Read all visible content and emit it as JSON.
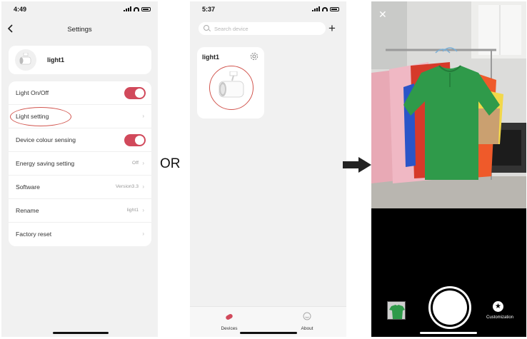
{
  "settings_screen": {
    "time": "4:49",
    "title": "Settings",
    "device_name": "light1",
    "rows": [
      {
        "label": "Light On/Off",
        "value": "",
        "control": "toggle",
        "on": true
      },
      {
        "label": "Light setting",
        "value": "",
        "control": "chevron",
        "highlighted": true
      },
      {
        "label": "Device colour sensing",
        "value": "",
        "control": "toggle",
        "on": true
      },
      {
        "label": "Energy saving setting",
        "value": "Off",
        "control": "chevron"
      },
      {
        "label": "Software",
        "value": "Version3.3",
        "control": "chevron"
      },
      {
        "label": "Rename",
        "value": "light1",
        "control": "chevron"
      },
      {
        "label": "Factory reset",
        "value": "",
        "control": "chevron"
      }
    ],
    "toggle_color": "#d1495b",
    "highlight_color": "#d2564f"
  },
  "separator_text": "OR",
  "devices_screen": {
    "time": "5:37",
    "search_placeholder": "Search device",
    "device_name": "light1",
    "tabs": [
      {
        "label": "Devices",
        "icon": "capsule-icon",
        "color": "#d1495b"
      },
      {
        "label": "About",
        "icon": "smiley-icon",
        "color": "#999999"
      }
    ]
  },
  "camera_screen": {
    "customization_label": "Customization",
    "shirt_color": "#2f9a4a"
  }
}
